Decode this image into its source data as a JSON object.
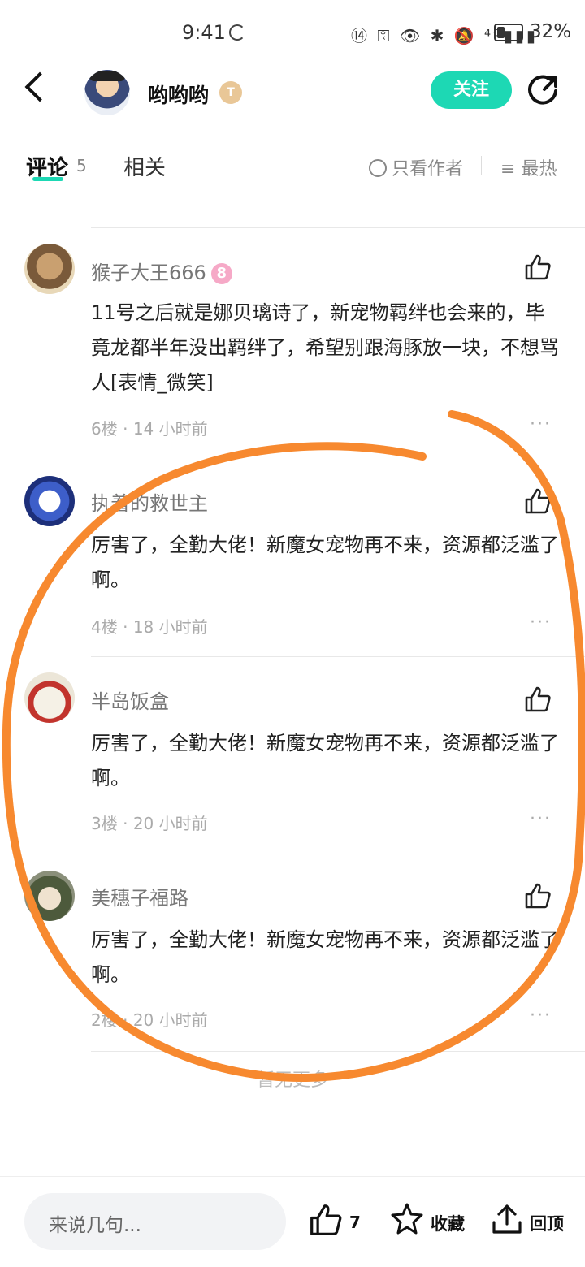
{
  "status_bar": {
    "time": "9:41",
    "signal_icons": "⑭ ⚿ 👁 ✱ 🔕 ⁴ᴳ▮▮▮",
    "battery_percent": "32%",
    "battery_level": 0.32
  },
  "header": {
    "author_name": "哟哟哟",
    "level_badge": "T",
    "follow_label": "关注"
  },
  "tabs": {
    "comments_label": "评论",
    "comments_count": "5",
    "related_label": "相关",
    "author_only_label": "只看作者",
    "sort_label": "最热"
  },
  "comments": [
    {
      "user": "猴子大王666",
      "badge": "8",
      "text": "11号之后就是娜贝璃诗了，新宠物羁绊也会来的，毕竟龙都半年没出羁绊了，希望别跟海豚放一块，不想骂人[表情_微笑]",
      "floor": "6楼",
      "time": "14 小时前"
    },
    {
      "user": "执着的救世主",
      "text": "厉害了，全勤大佬！新魔女宠物再不来，资源都泛滥了啊。",
      "floor": "4楼",
      "time": "18 小时前"
    },
    {
      "user": "半岛饭盒",
      "text": "厉害了，全勤大佬！新魔女宠物再不来，资源都泛滥了啊。",
      "floor": "3楼",
      "time": "20 小时前"
    },
    {
      "user": "美穗子福路",
      "text": "厉害了，全勤大佬！新魔女宠物再不来，资源都泛滥了啊。",
      "floor": "2楼",
      "time": "20 小时前"
    }
  ],
  "meta_separator": "·",
  "more_glyph": "···",
  "footer_note": "暂无更多",
  "bottom_bar": {
    "input_placeholder": "来说几句...",
    "like_count": "7",
    "favorite_label": "收藏",
    "back_to_top_label": "回顶"
  },
  "colors": {
    "accent": "#1dd8b4",
    "annotation": "#f7892f"
  }
}
